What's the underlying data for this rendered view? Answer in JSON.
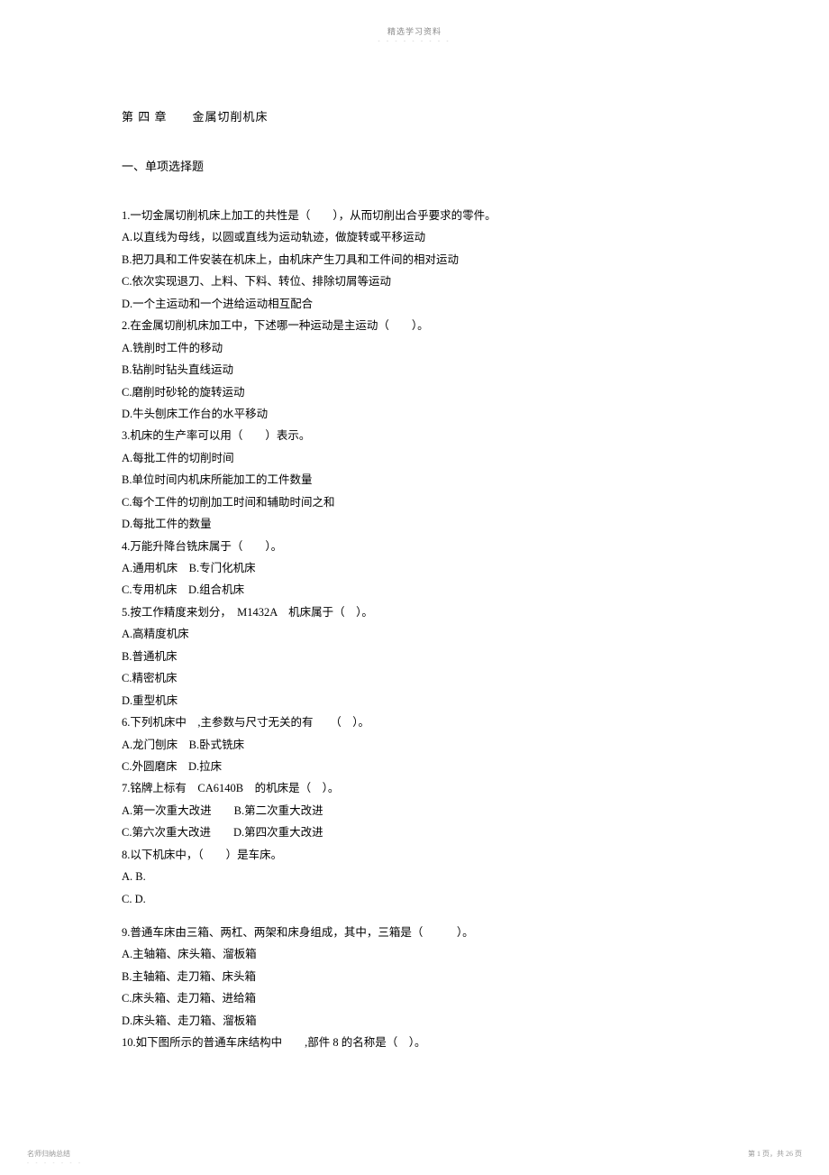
{
  "header": {
    "title": "精选学习资料",
    "sub": "- - - - - - - - -"
  },
  "chapter": "第 四 章　　金属切削机床",
  "section": "一、单项选择题",
  "lines": [
    "1.一切金属切削机床上加工的共性是（　　），从而切削出合乎要求的零件。",
    "A.以直线为母线，以圆或直线为运动轨迹，做旋转或平移运动",
    "B.把刀具和工件安装在机床上，由机床产生刀具和工件间的相对运动",
    "C.依次实现退刀、上料、下料、转位、排除切屑等运动",
    "D.一个主运动和一个进给运动相互配合",
    "2.在金属切削机床加工中，下述哪一种运动是主运动（　　）。",
    "A.铣削时工件的移动",
    "B.钻削时钻头直线运动",
    "C.磨削时砂轮的旋转运动",
    "D.牛头刨床工作台的水平移动",
    "3.机床的生产率可以用（　　）表示。",
    "A.每批工件的切削时间",
    "B.单位时间内机床所能加工的工件数量",
    "C.每个工件的切削加工时间和辅助时间之和",
    "D.每批工件的数量",
    "4.万能升降台铣床属于（　　）。",
    "A.通用机床　B.专门化机床",
    "C.专用机床　D.组合机床",
    "5.按工作精度来划分，　M1432A　机床属于（　）。",
    "A.高精度机床",
    "B.普通机床",
    "C.精密机床",
    "D.重型机床",
    "6.下列机床中　,主参数与尺寸无关的有　　（　）。",
    "A.龙门刨床　B.卧式铣床",
    "C.外圆磨床　D.拉床",
    "7.铭牌上标有　CA6140B　的机床是（　）。",
    "A.第一次重大改进　　B.第二次重大改进",
    "C.第六次重大改进　　D.第四次重大改进",
    "8.以下机床中，（　　）是车床。",
    "A. B.",
    "C. D."
  ],
  "lines2": [
    "9.普通车床由三箱、两杠、两架和床身组成，其中，三箱是（　　　）。",
    "A.主轴箱、床头箱、溜板箱",
    "B.主轴箱、走刀箱、床头箱",
    "C.床头箱、走刀箱、进给箱",
    "D.床头箱、走刀箱、溜板箱",
    "10.如下图所示的普通车床结构中　　,部件 8 的名称是（　）。"
  ],
  "footer": {
    "left": "名师归纳总结",
    "left_sub": "- - - - - - -",
    "right": "第 1 页，共 26 页"
  }
}
